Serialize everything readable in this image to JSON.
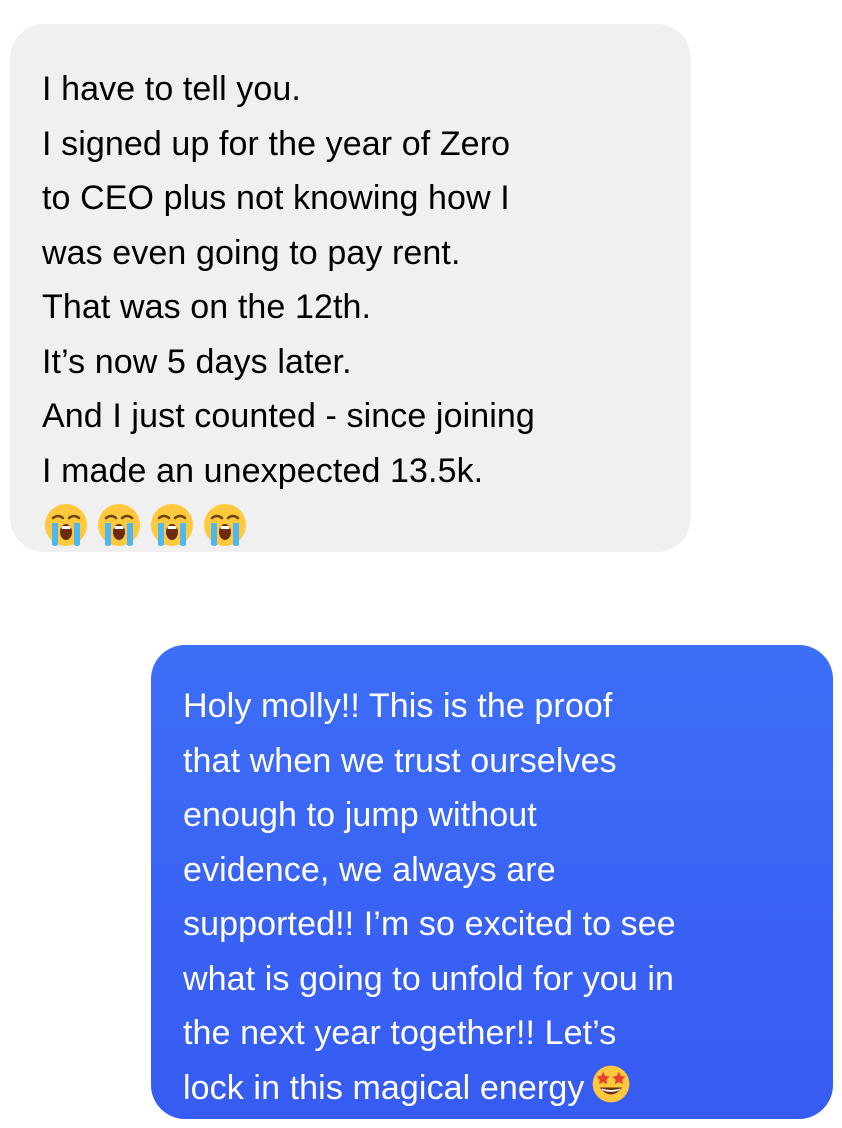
{
  "conversation": {
    "received": {
      "lines": [
        "I have to tell you.",
        "I signed up for the year of Zero",
        "to CEO plus not knowing how I",
        "was even going to pay rent.",
        "That was on the 12th.",
        "It’s now 5 days later.",
        "And I just counted - since joining",
        "I made an unexpected 13.5k."
      ],
      "emojis": [
        "loudly-crying-face",
        "loudly-crying-face",
        "loudly-crying-face",
        "loudly-crying-face"
      ],
      "bubble_color": "#f0f0f0",
      "text_color": "#000000"
    },
    "sent": {
      "lines": [
        "Holy molly!! This is the proof",
        "that when we trust ourselves",
        "enough to jump without",
        "evidence, we always are",
        "supported!! I’m so excited to see",
        "what is going to unfold for you in",
        "the next year together!! Let’s",
        "lock in this magical energy"
      ],
      "trailing_emoji": "star-struck-face",
      "bubble_color": "#3a64f5",
      "text_color": "#ffffff"
    }
  }
}
